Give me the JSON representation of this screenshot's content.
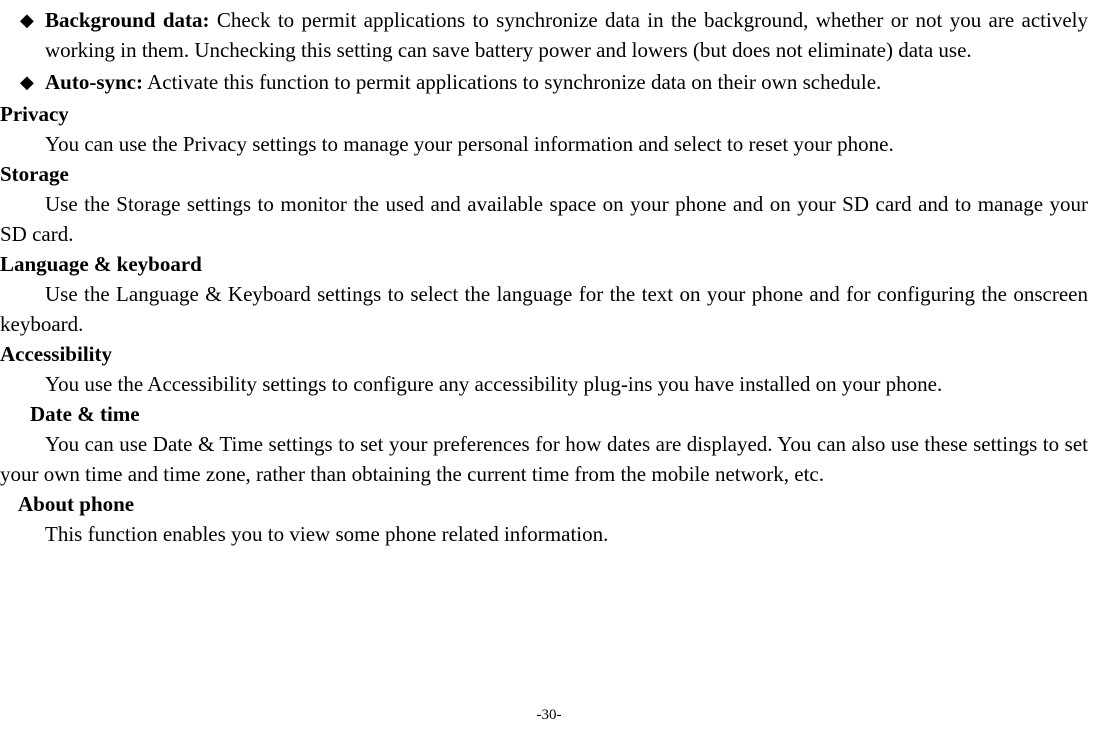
{
  "bullets": [
    {
      "label": "Background data:",
      "text": " Check to permit applications to synchronize data in the background, whether or not you are actively working in them. Unchecking this setting can save battery power and lowers (but does not eliminate) data use."
    },
    {
      "label": "Auto-sync:",
      "text": " Activate this function to permit applications to synchronize data on their own schedule."
    }
  ],
  "sections": [
    {
      "heading": "Privacy",
      "body": "You can use the Privacy settings to manage your personal information and select to reset your phone.",
      "indent": "none"
    },
    {
      "heading": "Storage",
      "body": "Use the Storage settings to monitor the used and available space on your phone and on your SD card and to manage your SD card.",
      "indent": "none"
    },
    {
      "heading": "Language & keyboard",
      "body": "Use the Language & Keyboard settings to select the language for the text on your phone and for configuring the onscreen keyboard.",
      "indent": "none"
    },
    {
      "heading": "Accessibility",
      "body": "You use the Accessibility settings to configure any accessibility plug-ins you have installed on your phone.",
      "indent": "none"
    },
    {
      "heading": "Date & time",
      "body": "You can use Date & Time settings to set your preferences for how dates are displayed. You can also use these settings to set your own time and time zone, rather than obtaining the current time from the mobile network, etc.",
      "indent": "indent1"
    },
    {
      "heading": "About phone",
      "body": "This function enables you to view some phone related information.",
      "indent": "indent2"
    }
  ],
  "pageNumber": "-30-"
}
